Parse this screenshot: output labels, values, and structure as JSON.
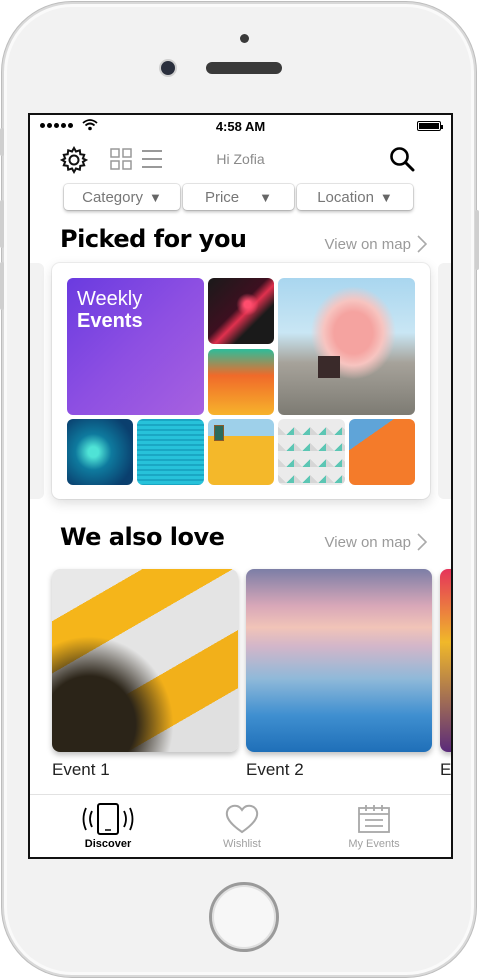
{
  "status_bar": {
    "time": "4:58 AM"
  },
  "header": {
    "greeting": "Hi Zofia",
    "icons": [
      "gear-icon",
      "grid-view-icon",
      "list-view-icon",
      "search-icon"
    ]
  },
  "filters": [
    {
      "label": "Category"
    },
    {
      "label": "Price"
    },
    {
      "label": "Location"
    }
  ],
  "picked": {
    "title": "Picked for you",
    "view_map": "View on map",
    "feature_line1": "Weekly",
    "feature_line2": "Events"
  },
  "also_love": {
    "title": "We also love",
    "view_map": "View on map",
    "events": [
      {
        "label": "Event 1"
      },
      {
        "label": "Event 2"
      },
      {
        "label": "E"
      }
    ]
  },
  "tabbar": [
    {
      "label": "Discover",
      "icon": "phone-vibrate-icon",
      "active": true
    },
    {
      "label": "Wishlist",
      "icon": "heart-icon",
      "active": false
    },
    {
      "label": "My Events",
      "icon": "calendar-icon",
      "active": false
    }
  ],
  "colors": {
    "accent": "#6a3be0",
    "active_tab": "#000000",
    "inactive_tab": "#a0a0a0",
    "secondary_text": "#9a9a9a"
  }
}
